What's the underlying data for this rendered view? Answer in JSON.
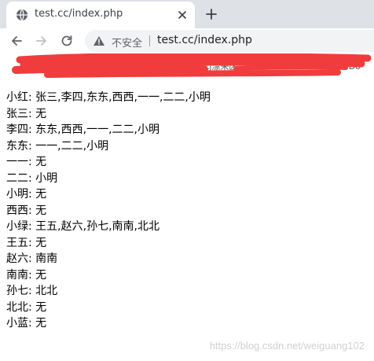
{
  "browser": {
    "tab_title": "test.cc/index.php",
    "security_label": "不安全",
    "url": "test.cc/index.php",
    "redacted_text_fragments": [
      "kj漂来区",
      "/Do"
    ]
  },
  "page": {
    "lines": [
      "小红: 张三,李四,东东,西西,一一,二二,小明",
      "张三: 无",
      "李四: 东东,西西,一一,二二,小明",
      "东东: 一一,二二,小明",
      "一一: 无",
      "二二: 小明",
      "小明: 无",
      "西西: 无",
      "小绿: 王五,赵六,孙七,南南,北北",
      "王五: 无",
      "赵六: 南南",
      "南南: 无",
      "孙七: 北北",
      "北北: 无",
      "小蓝: 无"
    ]
  },
  "watermark": "https://blog.csdn.net/weiguang102",
  "icons": {
    "favicon": "globe-icon",
    "close": "close-icon",
    "new_tab": "plus-icon",
    "back": "arrow-left-icon",
    "forward": "arrow-right-icon",
    "reload": "reload-icon",
    "security": "warning-triangle-icon"
  },
  "colors": {
    "tabstrip": "#dee1e6",
    "omnibox": "#f1f3f4",
    "redaction": "#f03c3c"
  }
}
